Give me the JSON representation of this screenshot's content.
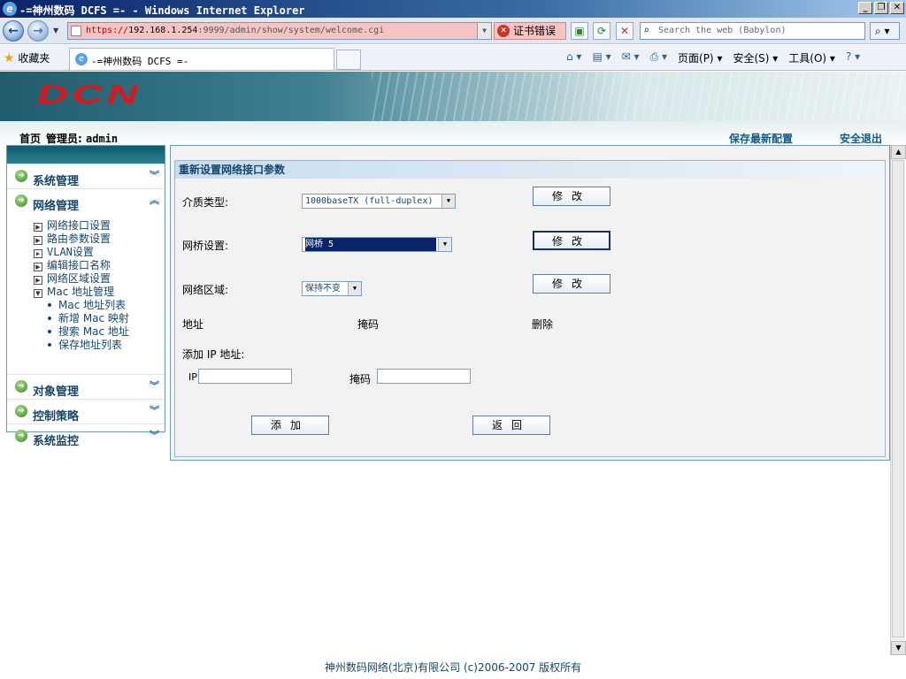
{
  "window": {
    "title": "-=神州数码 DCFS =- - Windows Internet Explorer"
  },
  "address": {
    "scheme": "https://",
    "host": "192.168.1.254",
    "rest": ":9999/admin/show/system/welcome.cgi",
    "cert_error": "证书错误",
    "search_placeholder": "Search the web (Babylon)"
  },
  "favbar": {
    "favorites": "收藏夹",
    "tab_title": "-=神州数码 DCFS =-",
    "page_menu": "页面(P)",
    "safety_menu": "安全(S)",
    "tools_menu": "工具(O)"
  },
  "banner": {
    "logo": "DCN"
  },
  "subheader": {
    "home": "首页",
    "admin_label": "管理员:",
    "admin_name": "admin",
    "save_config": "保存最新配置",
    "logout": "安全退出"
  },
  "sidebar": {
    "sections": [
      "系统管理",
      "网络管理",
      "对象管理",
      "控制策略",
      "系统监控"
    ],
    "network_items": [
      "网络接口设置",
      "路由参数设置",
      "VLAN设置",
      "编辑接口名称",
      "网络区域设置"
    ],
    "mac_group": "Mac 地址管理",
    "mac_items": [
      "Mac 地址列表",
      "新增 Mac 映射",
      "搜索 Mac 地址",
      "保存地址列表"
    ]
  },
  "form": {
    "heading": "重新设置网络接口参数",
    "media_label": "介质类型:",
    "media_value": "1000baseTX (full-duplex)",
    "bridge_label": "网桥设置:",
    "bridge_value": "网桥 5",
    "zone_label": "网络区域:",
    "zone_value": "保持不变",
    "modify": "修改",
    "col_address": "地址",
    "col_mask": "掩码",
    "col_delete": "删除",
    "add_ip_label": "添加 IP 地址:",
    "ip_label": "IP",
    "mask_label": "掩码",
    "add_button": "添加",
    "back_button": "返回"
  },
  "footer": {
    "copyright": "神州数码网络(北京)有限公司 (c)2006-2007 版权所有"
  }
}
